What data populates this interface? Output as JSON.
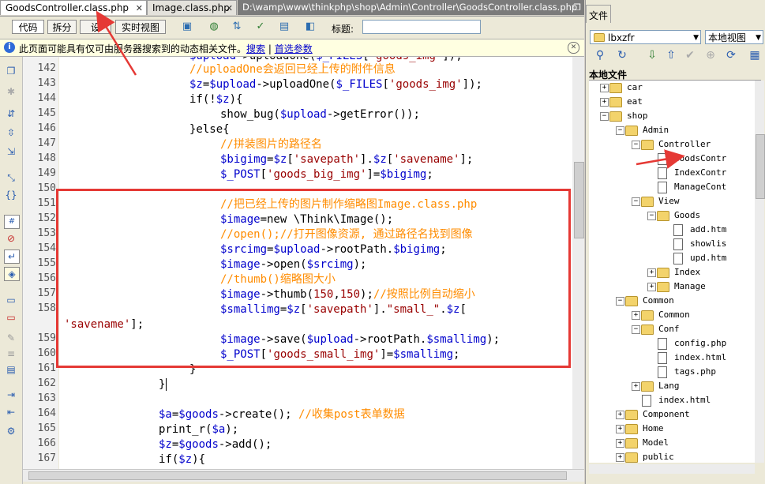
{
  "tabs": [
    {
      "label": "GoodsController.class.php"
    },
    {
      "label": "Image.class.php"
    },
    {
      "label": "D:\\wamp\\www\\thinkphp\\shop\\Admin\\Controller\\GoodsController.class.php"
    }
  ],
  "toolbar": {
    "code_label": "代码",
    "split_label": "拆分",
    "design_label": "设",
    "live_label": "实时视图",
    "title_label": "标题:",
    "title_value": ""
  },
  "infobar": {
    "text": "此页面可能具有仅可由服务器搜索到的动态相关文件。",
    "search_link": "搜索",
    "sep": " | ",
    "prefs_link": "首选参数"
  },
  "line_numbers": [
    "142",
    "143",
    "144",
    "145",
    "146",
    "147",
    "148",
    "149",
    "150",
    "151",
    "152",
    "153",
    "154",
    "155",
    "156",
    "157",
    "158",
    "",
    "159",
    "160",
    "161",
    "162",
    "163",
    "164",
    "165",
    "166",
    "167"
  ],
  "files_panel": {
    "tab_label": "文件",
    "site_select": "lbxzfr",
    "view_select": "本地视图",
    "local_header": "本地文件",
    "tree": [
      {
        "label": "car"
      },
      {
        "label": "eat"
      },
      {
        "label": "shop"
      },
      {
        "label": "Admin"
      },
      {
        "label": "Controller"
      },
      {
        "label": "GoodsContr"
      },
      {
        "label": "IndexContr"
      },
      {
        "label": "ManageCont"
      },
      {
        "label": "View"
      },
      {
        "label": "Goods"
      },
      {
        "label": "add.htm"
      },
      {
        "label": "showlis"
      },
      {
        "label": "upd.htm"
      },
      {
        "label": "Index"
      },
      {
        "label": "Manage"
      },
      {
        "label": "Common"
      },
      {
        "label": "Common"
      },
      {
        "label": "Conf"
      },
      {
        "label": "config.php"
      },
      {
        "label": "index.html"
      },
      {
        "label": "tags.php"
      },
      {
        "label": "Lang"
      },
      {
        "label": "index.html"
      },
      {
        "label": "Component"
      },
      {
        "label": "Home"
      },
      {
        "label": "Model"
      },
      {
        "label": "public"
      }
    ]
  },
  "colors": {
    "highlight_box": "#e53935",
    "comment": "#ff8c00",
    "variable": "#0000cc",
    "string": "#990000"
  }
}
